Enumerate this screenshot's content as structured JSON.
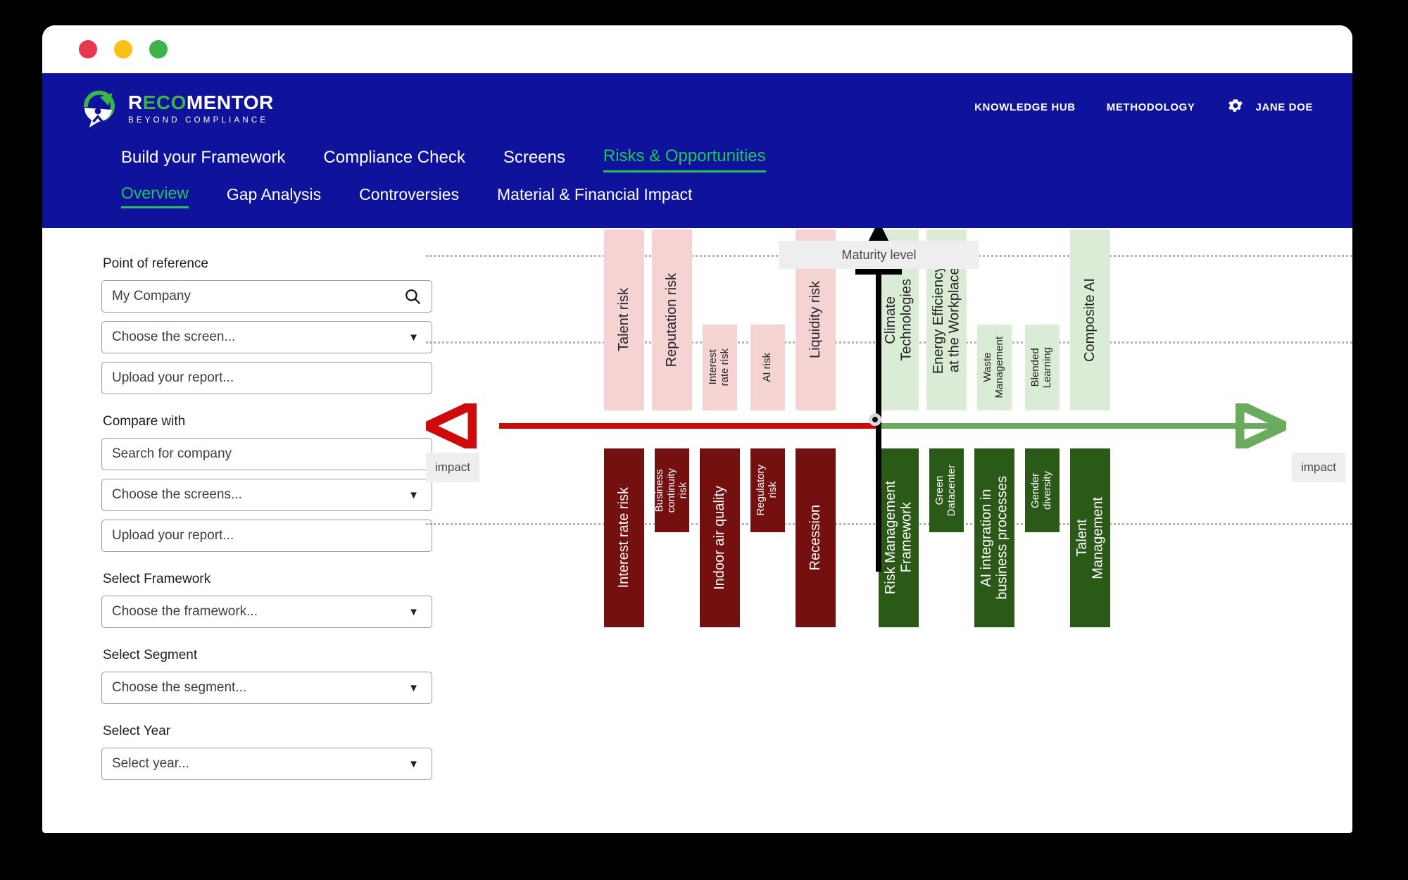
{
  "window": {
    "traffic_lights": [
      "close",
      "minimize",
      "maximize"
    ]
  },
  "brand": {
    "name_part1": "R",
    "name_part2": "ECO",
    "name_part3": "MENTOR",
    "tagline": "BEYOND COMPLIANCE",
    "accent_green": "#3cb44a",
    "header_blue": "#0f139b"
  },
  "header": {
    "links": [
      {
        "label": "KNOWLEDGE HUB",
        "name": "knowledge-hub"
      },
      {
        "label": "METHODOLOGY",
        "name": "methodology"
      }
    ],
    "user": {
      "label": "JANE DOE",
      "icon": "gear-icon"
    }
  },
  "main_nav": [
    {
      "label": "Build your Framework",
      "active": false
    },
    {
      "label": "Compliance Check",
      "active": false
    },
    {
      "label": "Screens",
      "active": false
    },
    {
      "label": "Risks & Opportunities",
      "active": true
    }
  ],
  "sub_nav": [
    {
      "label": "Overview",
      "active": true
    },
    {
      "label": "Gap Analysis",
      "active": false
    },
    {
      "label": "Controversies",
      "active": false
    },
    {
      "label": "Material  & Financial Impact",
      "active": false
    }
  ],
  "sidebar": {
    "groups": [
      {
        "label": "Point of reference",
        "fields": [
          {
            "name": "company-search-input",
            "value": "My Company",
            "type": "search"
          },
          {
            "name": "screen-select",
            "value": "Choose the screen...",
            "type": "select"
          },
          {
            "name": "upload-report-input",
            "value": "Upload your report...",
            "type": "text"
          }
        ]
      },
      {
        "label": "Compare with",
        "fields": [
          {
            "name": "compare-company-input",
            "value": "Search for company",
            "type": "text"
          },
          {
            "name": "screens-select",
            "value": "Choose the screens...",
            "type": "select"
          },
          {
            "name": "compare-upload-input",
            "value": "Upload your report...",
            "type": "text"
          }
        ]
      },
      {
        "label": "Select Framework",
        "fields": [
          {
            "name": "framework-select",
            "value": "Choose the framework...",
            "type": "select"
          }
        ]
      },
      {
        "label": "Select Segment",
        "fields": [
          {
            "name": "segment-select",
            "value": "Choose the segment...",
            "type": "select"
          }
        ]
      },
      {
        "label": "Select Year",
        "fields": [
          {
            "name": "year-select",
            "value": "Select year...",
            "type": "select"
          }
        ]
      }
    ]
  },
  "chart_data": {
    "type": "bar",
    "title": "",
    "vertical_axis_label": "Maturity level",
    "horizontal_axis_left_label": "impact",
    "horizontal_axis_right_label": "impact",
    "xlabel": "impact",
    "ylabel": "Maturity level",
    "grid": true,
    "legend_position": "none",
    "axis_colors": {
      "risk": "#cf0a0a",
      "opportunity": "#6aab5e",
      "maturity": "#000000"
    },
    "bar_colors": {
      "risk_upper": "#f6d3d3",
      "risk_lower": "#741010",
      "opportunity_upper": "#dbecd6",
      "opportunity_lower": "#2b5917"
    },
    "quadrants": [
      {
        "name": "risk-upper",
        "side": "left",
        "vertical": "up",
        "items": [
          {
            "label": "Talent risk",
            "height": 2
          },
          {
            "label": "Reputation risk",
            "height": 2
          },
          {
            "label": "Interest\nrate risk",
            "height": 1
          },
          {
            "label": "AI risk",
            "height": 1
          },
          {
            "label": "Liquidity risk",
            "height": 2
          }
        ]
      },
      {
        "name": "opportunity-upper",
        "side": "right",
        "vertical": "up",
        "items": [
          {
            "label": "Climate\nTechnologies",
            "height": 2
          },
          {
            "label": "Energy Efficiency\nat the Workplace",
            "height": 2
          },
          {
            "label": "Waste\nManagement",
            "height": 1
          },
          {
            "label": "Blended\nLearning",
            "height": 1
          },
          {
            "label": "Composite AI",
            "height": 2
          }
        ]
      },
      {
        "name": "risk-lower",
        "side": "left",
        "vertical": "down",
        "items": [
          {
            "label": "Interest rate risk",
            "height": 2
          },
          {
            "label": "Business\ncontinuity\nrisk",
            "height": 1
          },
          {
            "label": "Indoor air quality",
            "height": 2
          },
          {
            "label": "Regulatory\nrisk",
            "height": 1
          },
          {
            "label": "Recession",
            "height": 2
          }
        ]
      },
      {
        "name": "opportunity-lower",
        "side": "right",
        "vertical": "down",
        "items": [
          {
            "label": "Risk Management\nFramework",
            "height": 2
          },
          {
            "label": "Green\nDatacenter",
            "height": 1
          },
          {
            "label": "AI integration in\nbusiness processes",
            "height": 2
          },
          {
            "label": "Gender\ndiversity",
            "height": 1
          },
          {
            "label": "Talent\nManagement",
            "height": 2
          }
        ]
      }
    ]
  }
}
